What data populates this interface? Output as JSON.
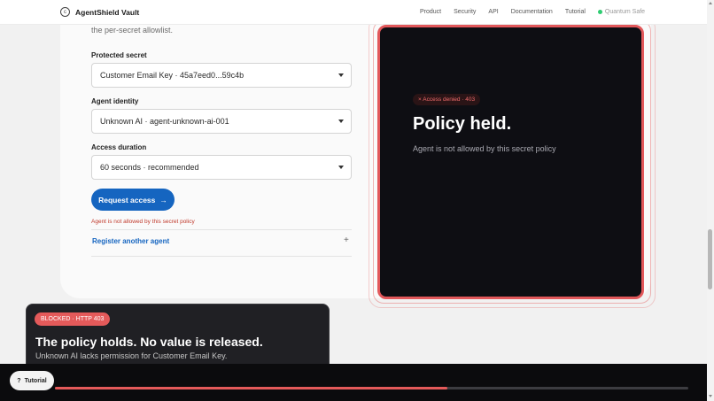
{
  "nav": {
    "logo_glyph": "c",
    "brand": "AgentShield Vault",
    "links": [
      "Product",
      "Security",
      "API",
      "Documentation",
      "Tutorial"
    ],
    "status": "Quantum Safe",
    "status_color": "#2ecc71"
  },
  "form": {
    "intro": "the per-secret allowlist.",
    "secret_label": "Protected secret",
    "secret_value": "Customer Email Key · 45a7eed0...59c4b",
    "agent_label": "Agent identity",
    "agent_value": "Unknown AI · agent-unknown-ai-001",
    "duration_label": "Access duration",
    "duration_value": "60 seconds · recommended",
    "request_button": "Request access",
    "request_arrow": "→",
    "error": "Agent is not allowed by this secret policy",
    "register_label": "Register another agent",
    "register_plus": "+"
  },
  "panel": {
    "badge": "× Access denied · 403",
    "title": "Policy held.",
    "subtitle": "Agent is not allowed by this secret policy",
    "accent_color": "#e2585b"
  },
  "toast": {
    "badge": "BLOCKED · HTTP 403",
    "title": "The policy holds. No value is released.",
    "subtitle": "Unknown AI lacks permission for Customer Email Key."
  },
  "tutorial": {
    "icon": "?",
    "label": "Tutorial",
    "progress": 0.62
  }
}
